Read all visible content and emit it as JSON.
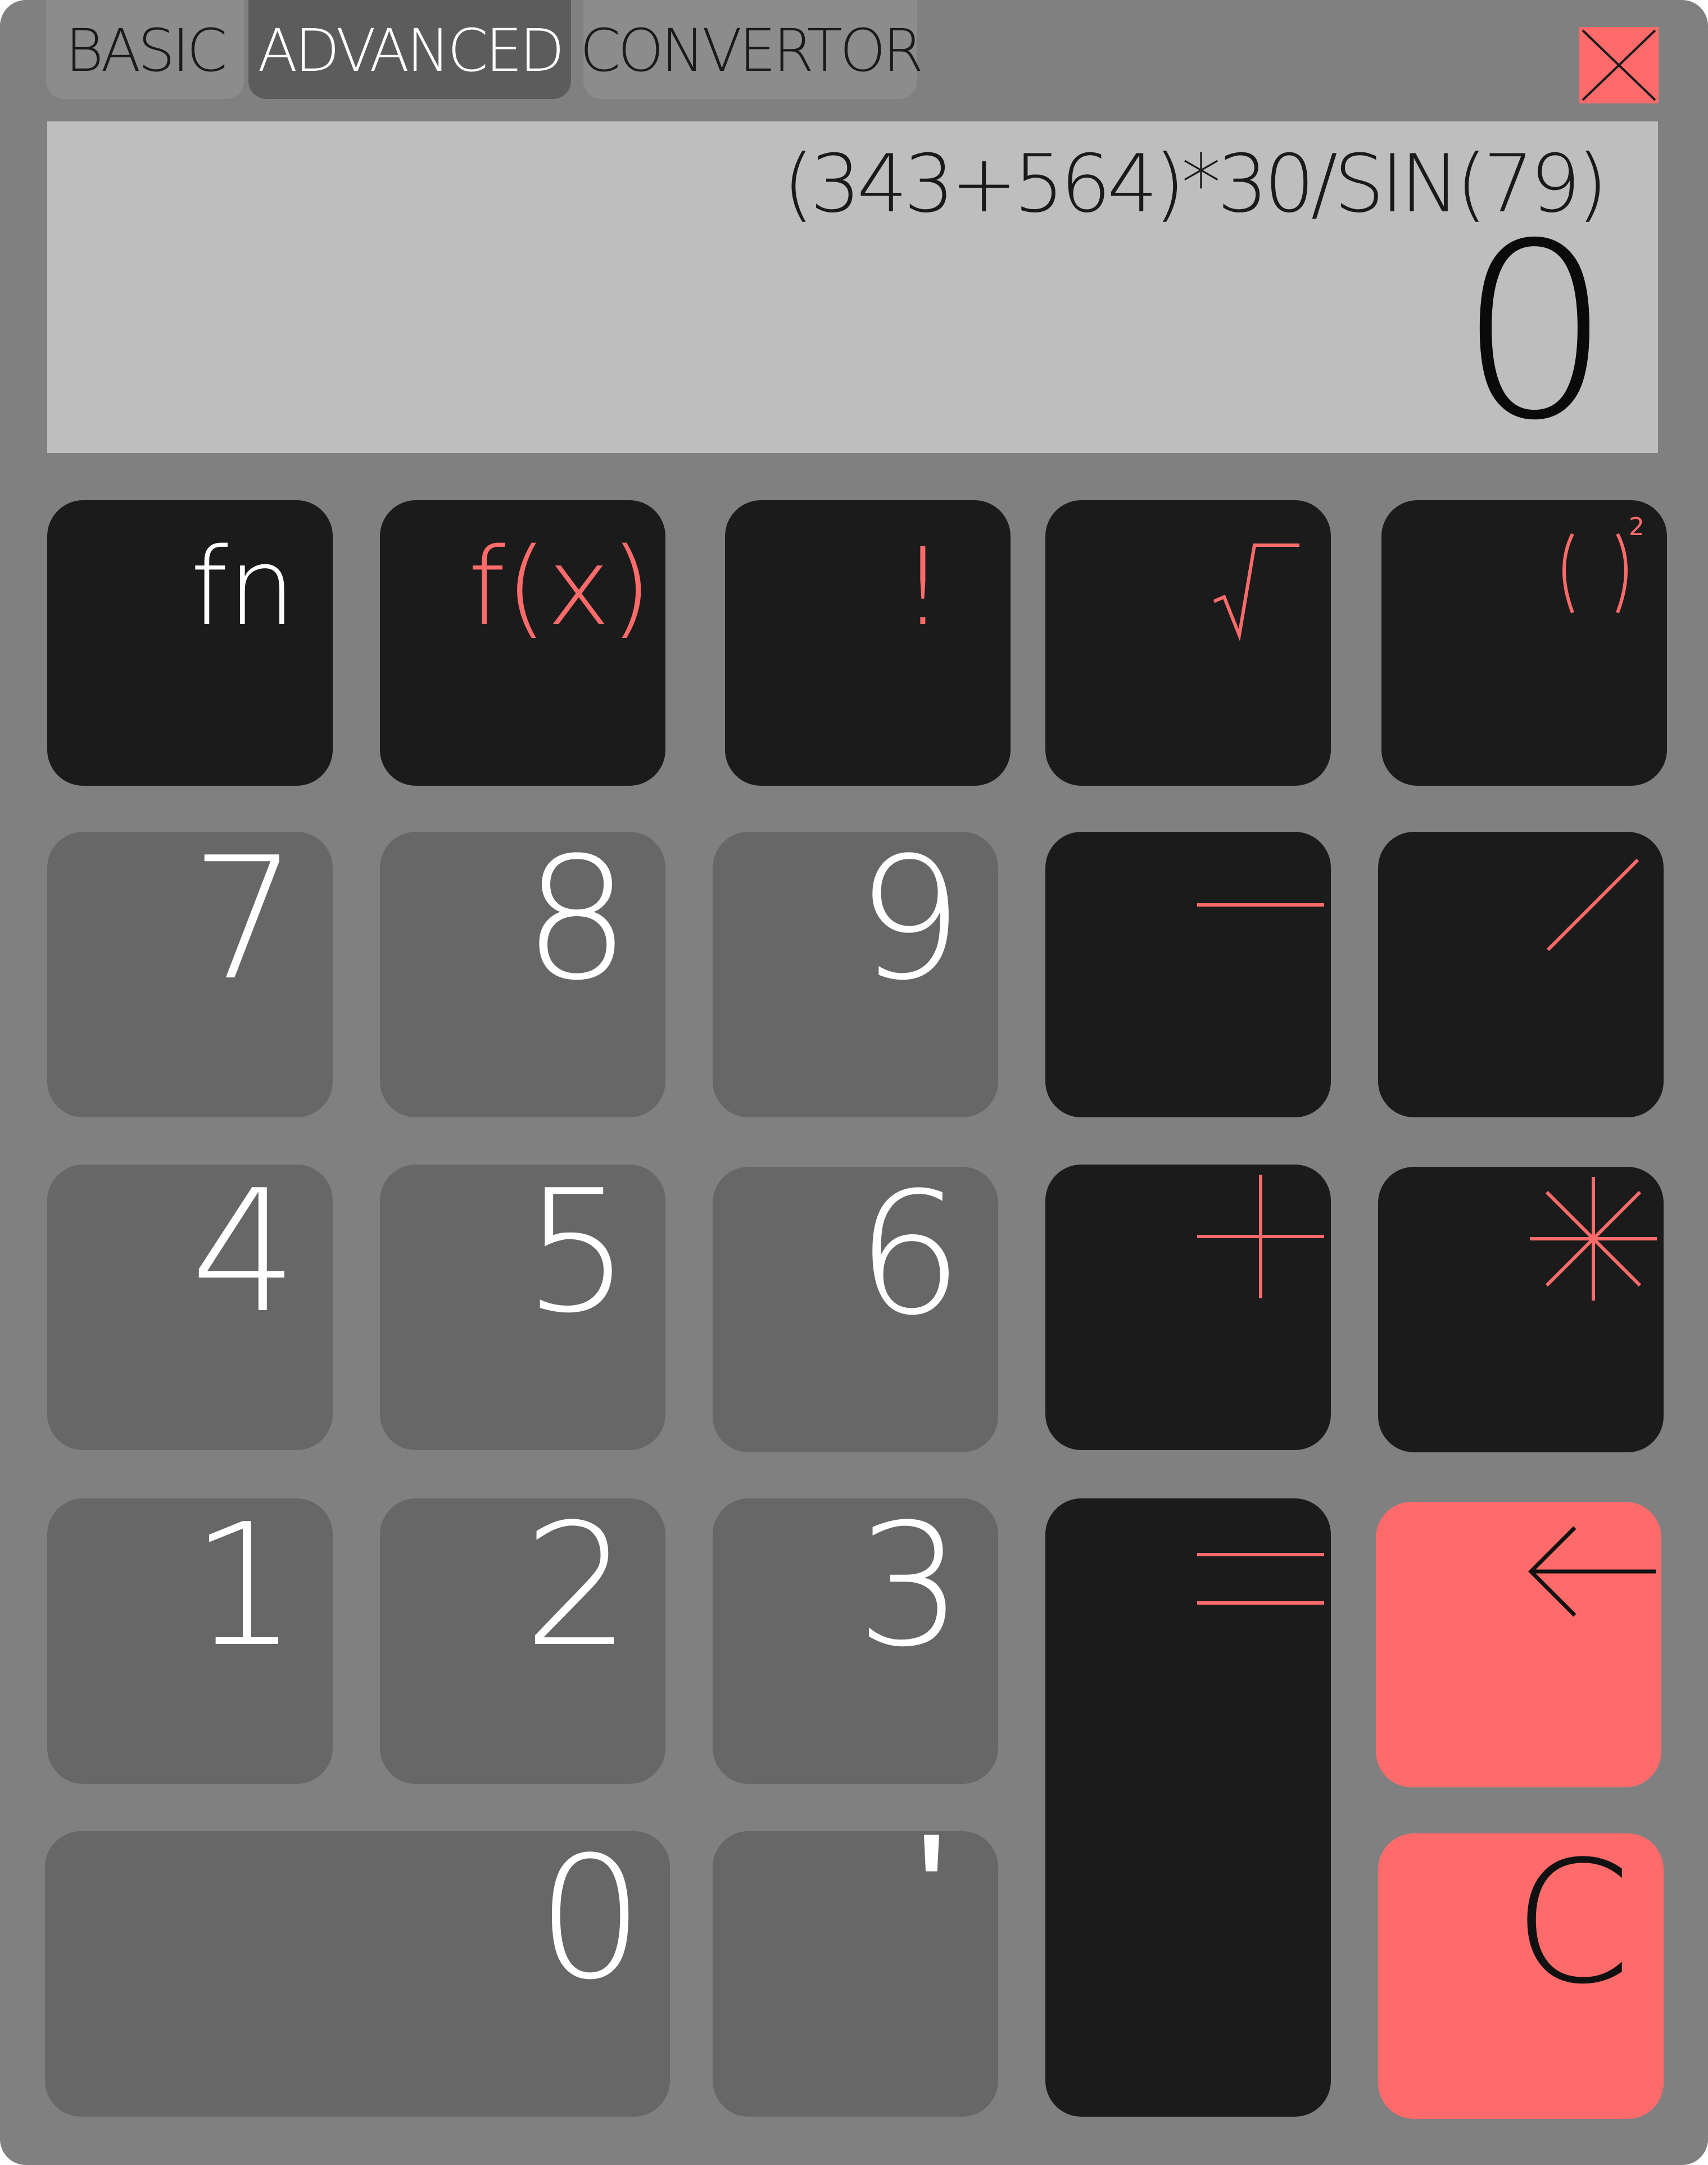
{
  "colors": {
    "frame": "#808080",
    "display": "#bebebe",
    "function_key": "#1b1b1b",
    "number_key": "#676767",
    "accent": "#ff6b6b"
  },
  "tabs": [
    {
      "label": "BASIC",
      "active": false
    },
    {
      "label": "ADVANCED",
      "active": true
    },
    {
      "label": "CONVERTOR",
      "active": false
    }
  ],
  "close_icon": "close-icon",
  "display": {
    "expression": "(343+564)*30/SIN(79)",
    "result": "0"
  },
  "keys": {
    "fn": "fn",
    "fx": "f(x)",
    "factorial": "!",
    "sqrt": "√‾",
    "square": "( )²",
    "seven": "7",
    "eight": "8",
    "nine": "9",
    "four": "4",
    "five": "5",
    "six": "6",
    "one": "1",
    "two": "2",
    "three": "3",
    "zero": "0",
    "decimal": "ʹ",
    "clear": "C",
    "minus_icon": "minus-icon",
    "divide_icon": "divide-icon",
    "plus_icon": "plus-icon",
    "multiply_icon": "asterisk-icon",
    "equals_icon": "equals-icon",
    "backspace_icon": "arrow-left-icon"
  }
}
